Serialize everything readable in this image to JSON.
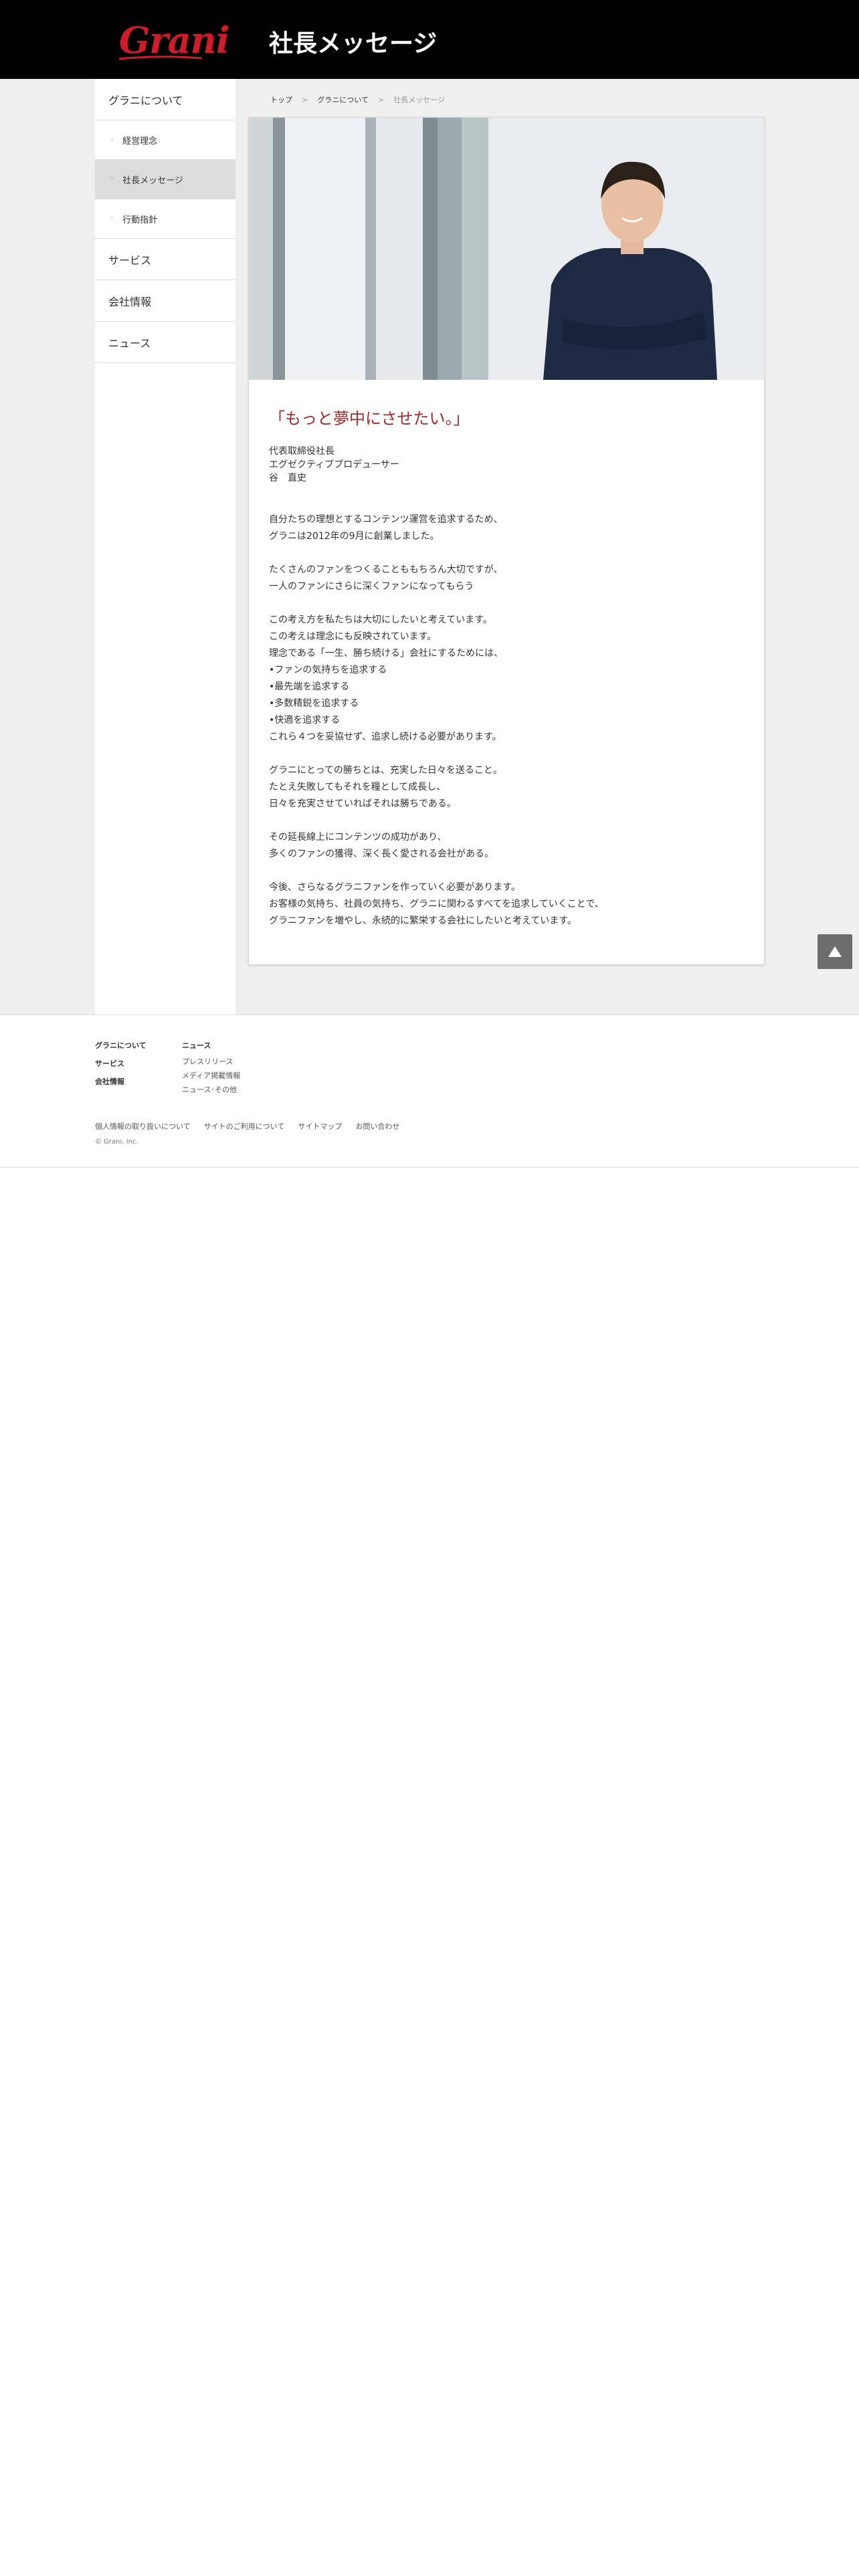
{
  "header": {
    "logo_text": "Grani",
    "page_title": "社長メッセージ"
  },
  "sidebar": {
    "items": [
      {
        "label": "グラニについて",
        "level": "main"
      },
      {
        "label": "経営理念",
        "level": "sub"
      },
      {
        "label": "社長メッセージ",
        "level": "sub",
        "active": true
      },
      {
        "label": "行動指針",
        "level": "sub"
      },
      {
        "label": "サービス",
        "level": "main"
      },
      {
        "label": "会社情報",
        "level": "main"
      },
      {
        "label": "ニュース",
        "level": "main"
      }
    ]
  },
  "breadcrumb": {
    "items": [
      "トップ",
      "グラニについて",
      "社長メッセージ"
    ],
    "separator": ">"
  },
  "content": {
    "quote": "「もっと夢中にさせたい。」",
    "signature": [
      "代表取締役社長",
      "エグゼクティブプロデューサー",
      "谷　直史"
    ],
    "paragraphs": [
      [
        "自分たちの理想とするコンテンツ運営を追求するため、",
        "グラニは2012年の9月に創業しました。"
      ],
      [
        "たくさんのファンをつくることももちろん大切ですが、",
        "一人のファンにさらに深くファンになってもらう"
      ],
      [
        "この考え方を私たちは大切にしたいと考えています。",
        "この考えは理念にも反映されています。",
        "理念である「一生、勝ち続ける」会社にするためには、",
        "•ファンの気持ちを追求する",
        "•最先端を追求する",
        "•多数精鋭を追求する",
        "•快適を追求する",
        "これら４つを妥協せず、追求し続ける必要があります。"
      ],
      [
        "グラニにとっての勝ちとは、充実した日々を送ること。",
        "たとえ失敗してもそれを糧として成長し、",
        "日々を充実させていればそれは勝ちである。"
      ],
      [
        "その延長線上にコンテンツの成功があり、",
        "多くのファンの獲得、深く長く愛される会社がある。"
      ],
      [
        "今後、さらなるグラニファンを作っていく必要があります。",
        "お客様の気持ち、社員の気持ち、グラニに関わるすべてを追求していくことで、",
        "グラニファンを増やし、永続的に繁栄する会社にしたいと考えています。"
      ]
    ]
  },
  "footer": {
    "col1": [
      "グラニについて",
      "サービス",
      "会社情報"
    ],
    "col2_title": "ニュース",
    "col2_items": [
      "プレスリリース",
      "メディア掲載情報",
      "ニュース･その他"
    ],
    "links": [
      "個人情報の取り扱いについて",
      "サイトのご利用について",
      "サイトマップ",
      "お問い合わせ"
    ],
    "copyright": "© Grani, Inc."
  },
  "colors": {
    "header_bg": "#000000",
    "accent_red": "#a12b2b",
    "logo_red": "#d11a2a",
    "band_bg": "#efefef",
    "active_item_bg": "#dcdcdc"
  }
}
